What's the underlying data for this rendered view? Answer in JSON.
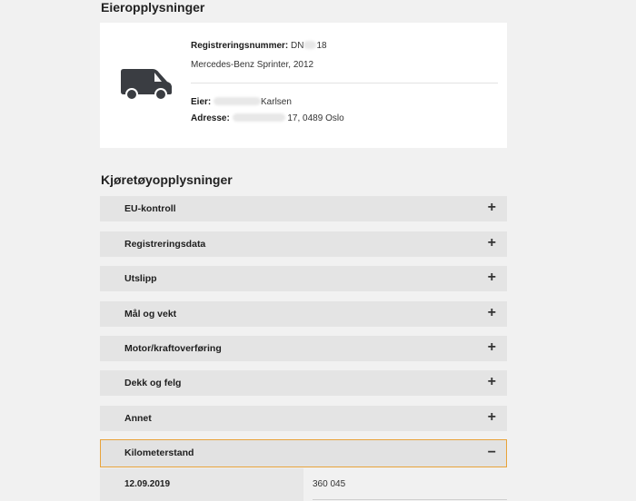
{
  "owner_section": {
    "title": "Eieropplysninger",
    "reg_label": "Registreringsnummer:",
    "reg_prefix": "DN",
    "reg_suffix": "18",
    "model": "Mercedes-Benz Sprinter, 2012",
    "owner_label": "Eier:",
    "owner_surname": "Karlsen",
    "address_label": "Adresse:",
    "address_suffix": "17, 0489 Oslo",
    "icon": "van-icon"
  },
  "vehicle_section": {
    "title": "Kjøretøyopplysninger",
    "items": [
      {
        "label": "EU-kontroll",
        "toggle": "+"
      },
      {
        "label": "Registreringsdata",
        "toggle": "+"
      },
      {
        "label": "Utslipp",
        "toggle": "+"
      },
      {
        "label": "Mål og vekt",
        "toggle": "+"
      },
      {
        "label": "Motor/kraftoverføring",
        "toggle": "+"
      },
      {
        "label": "Dekk og felg",
        "toggle": "+"
      },
      {
        "label": "Annet",
        "toggle": "+"
      },
      {
        "label": "Kilometerstand",
        "toggle": "−"
      }
    ]
  },
  "mileage": {
    "date": "12.09.2019",
    "value": "360 045"
  },
  "colors": {
    "accent_border": "#e8a33a",
    "background": "#f1f1f1",
    "accordion": "#e4e4e4"
  }
}
